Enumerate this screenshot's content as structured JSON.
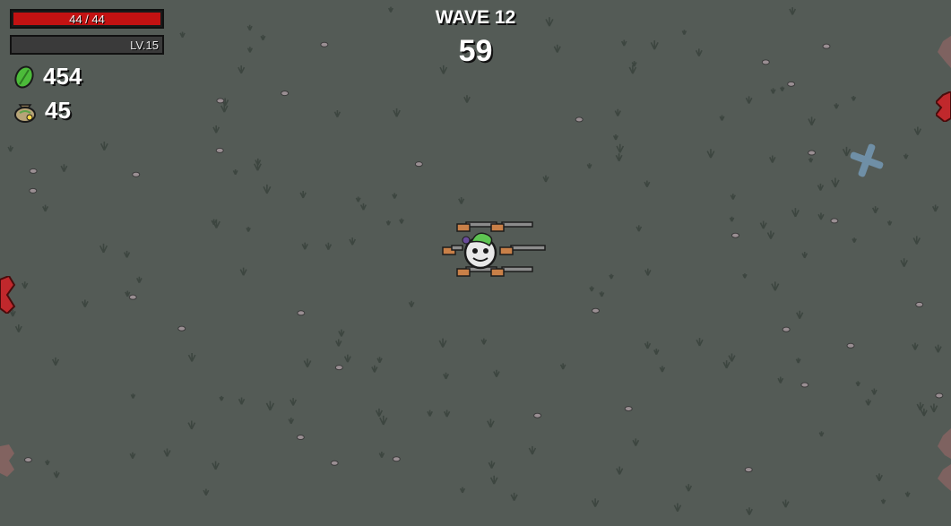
{
  "hud": {
    "health_text": "44 / 44",
    "health_fraction": 1.0,
    "level_text": "LV.15",
    "xp_fraction": 0.0,
    "materials": "454",
    "bag_count": "45"
  },
  "wave": {
    "title": "WAVE 12",
    "timer": "59"
  },
  "colors": {
    "ground": "#545b56",
    "health": "#c31212",
    "material_green": "#4cbb3a",
    "enemy_red": "#c0282c",
    "mark_blue": "#6f8fa6"
  },
  "icons": {
    "materials": "green-leaf-icon",
    "bag": "money-bag-icon"
  }
}
